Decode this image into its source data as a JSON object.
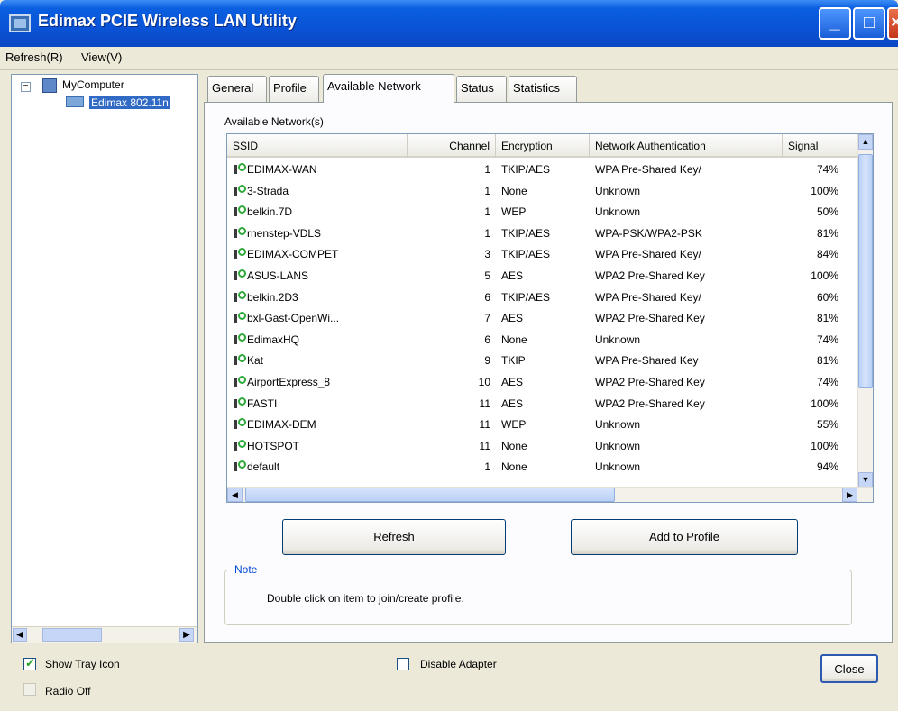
{
  "window": {
    "title": "Edimax PCIE Wireless LAN Utility"
  },
  "menu": {
    "items": [
      "Refresh(R)",
      "View(V)"
    ]
  },
  "tree": {
    "root": "MyComputer",
    "child": "Edimax 802.11n"
  },
  "tabs": [
    {
      "label": "General"
    },
    {
      "label": "Profile"
    },
    {
      "label": "Available Network"
    },
    {
      "label": "Status"
    },
    {
      "label": "Statistics"
    }
  ],
  "panel": {
    "available_label": "Available Network(s)",
    "columns": [
      "SSID",
      "Channel",
      "Encryption",
      "Network Authentication",
      "Signal"
    ],
    "networks": [
      {
        "ssid": "EDIMAX-WAN",
        "channel": "1",
        "encryption": "TKIP/AES",
        "auth": "WPA Pre-Shared Key/",
        "signal": "74%",
        "secured": true
      },
      {
        "ssid": "3-Strada",
        "channel": "1",
        "encryption": "None",
        "auth": "Unknown",
        "signal": "100%",
        "secured": false
      },
      {
        "ssid": "belkin.7D",
        "channel": "1",
        "encryption": "WEP",
        "auth": "Unknown",
        "signal": "50%",
        "secured": true
      },
      {
        "ssid": "rnenstep-VDLS",
        "channel": "1",
        "encryption": "TKIP/AES",
        "auth": "WPA-PSK/WPA2-PSK",
        "signal": "81%",
        "secured": false
      },
      {
        "ssid": "EDIMAX-COMPET",
        "channel": "3",
        "encryption": "TKIP/AES",
        "auth": "WPA Pre-Shared Key/",
        "signal": "84%",
        "secured": true
      },
      {
        "ssid": "ASUS-LANS",
        "channel": "5",
        "encryption": "AES",
        "auth": "WPA2 Pre-Shared Key",
        "signal": "100%",
        "secured": false
      },
      {
        "ssid": "belkin.2D3",
        "channel": "6",
        "encryption": "TKIP/AES",
        "auth": "WPA Pre-Shared Key/",
        "signal": "60%",
        "secured": true
      },
      {
        "ssid": "bxl-Gast-OpenWi...",
        "channel": "7",
        "encryption": "AES",
        "auth": "WPA2 Pre-Shared Key",
        "signal": "81%",
        "secured": false
      },
      {
        "ssid": "EdimaxHQ",
        "channel": "6",
        "encryption": "None",
        "auth": "Unknown",
        "signal": "74%",
        "secured": true
      },
      {
        "ssid": "Kat",
        "channel": "9",
        "encryption": "TKIP",
        "auth": "WPA Pre-Shared Key",
        "signal": "81%",
        "secured": false
      },
      {
        "ssid": "AirportExpress_8",
        "channel": "10",
        "encryption": "AES",
        "auth": "WPA2 Pre-Shared Key",
        "signal": "74%",
        "secured": true
      },
      {
        "ssid": "FASTI",
        "channel": "11",
        "encryption": "AES",
        "auth": "WPA2 Pre-Shared Key",
        "signal": "100%",
        "secured": false
      },
      {
        "ssid": "EDIMAX-DEM",
        "channel": "11",
        "encryption": "WEP",
        "auth": "Unknown",
        "signal": "55%",
        "secured": true
      },
      {
        "ssid": "HOTSPOT",
        "channel": "11",
        "encryption": "None",
        "auth": "Unknown",
        "signal": "100%",
        "secured": false
      },
      {
        "ssid": "default",
        "channel": "1",
        "encryption": "None",
        "auth": "Unknown",
        "signal": "94%",
        "secured": true
      }
    ],
    "refresh_label": "Refresh",
    "add_profile_label": "Add to Profile",
    "note_title": "Note",
    "note_text": "Double click on item to join/create profile."
  },
  "footer": {
    "show_tray_icon": "Show Tray Icon",
    "radio_off": "Radio Off",
    "disable_adapter": "Disable Adapter",
    "close_label": "Close"
  }
}
